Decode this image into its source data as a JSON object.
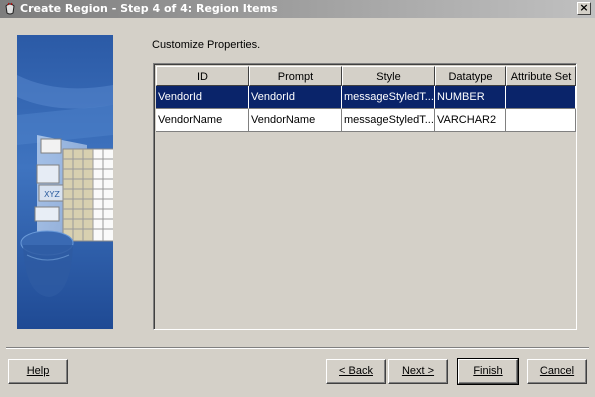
{
  "window": {
    "title": "Create Region - Step 4 of 4: Region Items",
    "close_label": "×"
  },
  "main": {
    "instruction": "Customize Properties."
  },
  "table": {
    "columns": [
      "ID",
      "Prompt",
      "Style",
      "Datatype",
      "Attribute Set"
    ],
    "rows": [
      {
        "id": "VendorId",
        "prompt": "VendorId",
        "style": "messageStyledT...",
        "datatype": "NUMBER",
        "attribute_set": "",
        "selected": true
      },
      {
        "id": "VendorName",
        "prompt": "VendorName",
        "style": "messageStyledT...",
        "datatype": "VARCHAR2",
        "attribute_set": "",
        "selected": false
      }
    ]
  },
  "buttons": {
    "help": "Help",
    "back": "< Back",
    "next": "Next >",
    "finish": "Finish",
    "cancel": "Cancel"
  },
  "colors": {
    "selection": "#0a246a",
    "dialog_background": "#d4d0c8"
  }
}
